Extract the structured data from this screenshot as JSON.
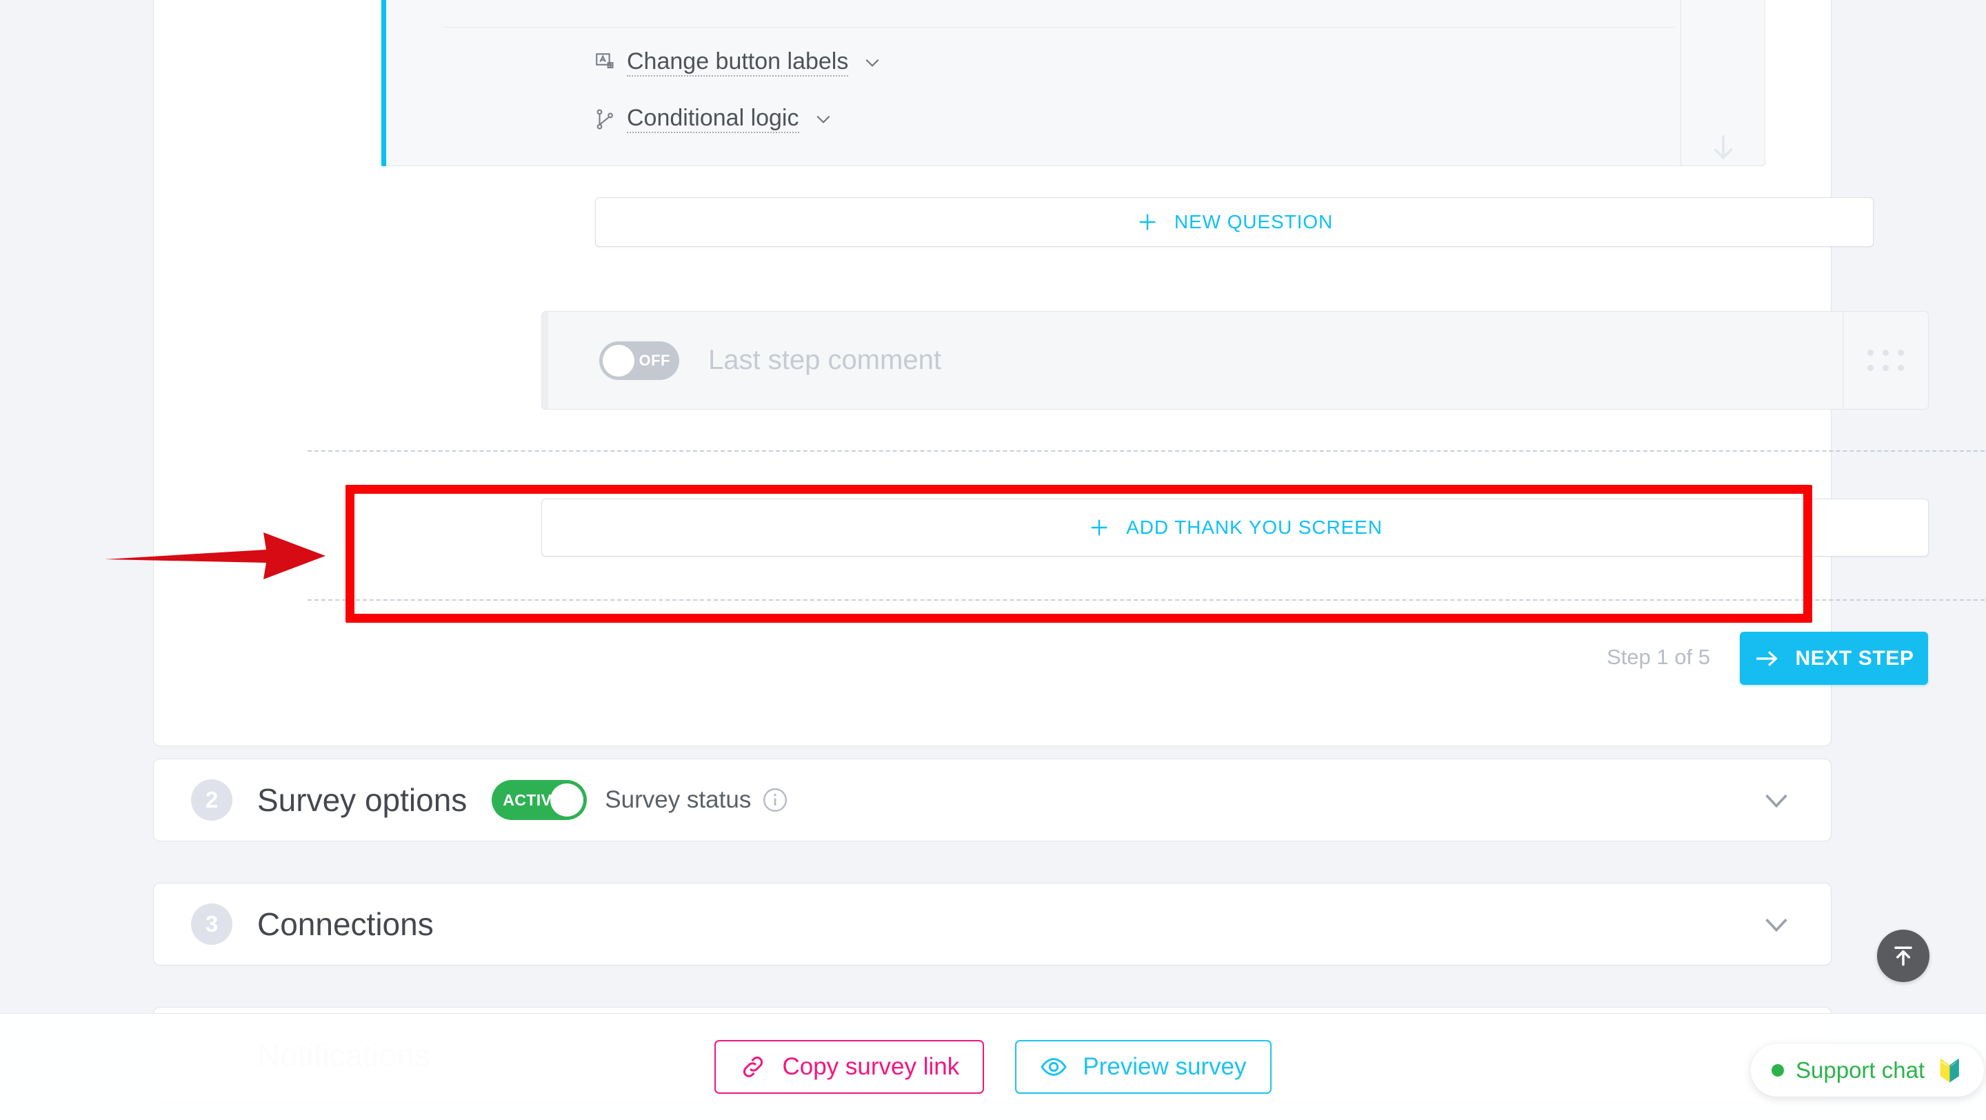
{
  "theme": {
    "page_bg": "#f2f4f8",
    "accent_cyan": "#0fc0f6",
    "accent_pink": "#f3157f",
    "accent_green": "#2eb153",
    "annotation_red": "#fa0000",
    "muted_text": "#b8bcc5"
  },
  "question_block": {
    "options": [
      {
        "icon": "text-box-plus-icon",
        "label": "Change button labels",
        "chevron": "chevron-down-icon"
      },
      {
        "icon": "branch-logic-icon",
        "label": "Conditional logic",
        "chevron": "chevron-down-icon"
      }
    ],
    "scroll_hint_icon": "arrow-down-icon"
  },
  "new_question": {
    "icon": "plus-icon",
    "label": "NEW QUESTION"
  },
  "last_step_comment": {
    "toggle_state": "OFF",
    "placeholder": "Last step comment",
    "drag_handle_icon": "drag-dots-icon"
  },
  "thank_you": {
    "icon": "plus-icon",
    "label": "ADD THANK YOU SCREEN",
    "annotation": {
      "type": "red-highlight-box-with-arrow",
      "color": "#fa0000"
    }
  },
  "step_footer": {
    "step_text": "Step 1 of 5",
    "next_button": {
      "icon": "arrow-right-icon",
      "label": "NEXT STEP"
    }
  },
  "sections": [
    {
      "number": "2",
      "title": "Survey options",
      "status_toggle": {
        "state": "ACTIVE",
        "on": true
      },
      "status_label": "Survey status",
      "info_icon": "info-icon",
      "expand_icon": "chevron-down-icon"
    },
    {
      "number": "3",
      "title": "Connections",
      "expand_icon": "chevron-down-icon"
    },
    {
      "number": "4",
      "title": "Notifications",
      "expand_icon": "chevron-down-icon"
    }
  ],
  "bottom_bar": {
    "copy_link": {
      "icon": "link-icon",
      "label": "Copy survey link"
    },
    "preview": {
      "icon": "eye-icon",
      "label": "Preview survey"
    }
  },
  "scroll_to_top": {
    "icon": "arrow-up-to-bar-icon"
  },
  "support_chat": {
    "status_dot_color": "#2bb34a",
    "label": "Support chat",
    "emoji": "🔰"
  }
}
